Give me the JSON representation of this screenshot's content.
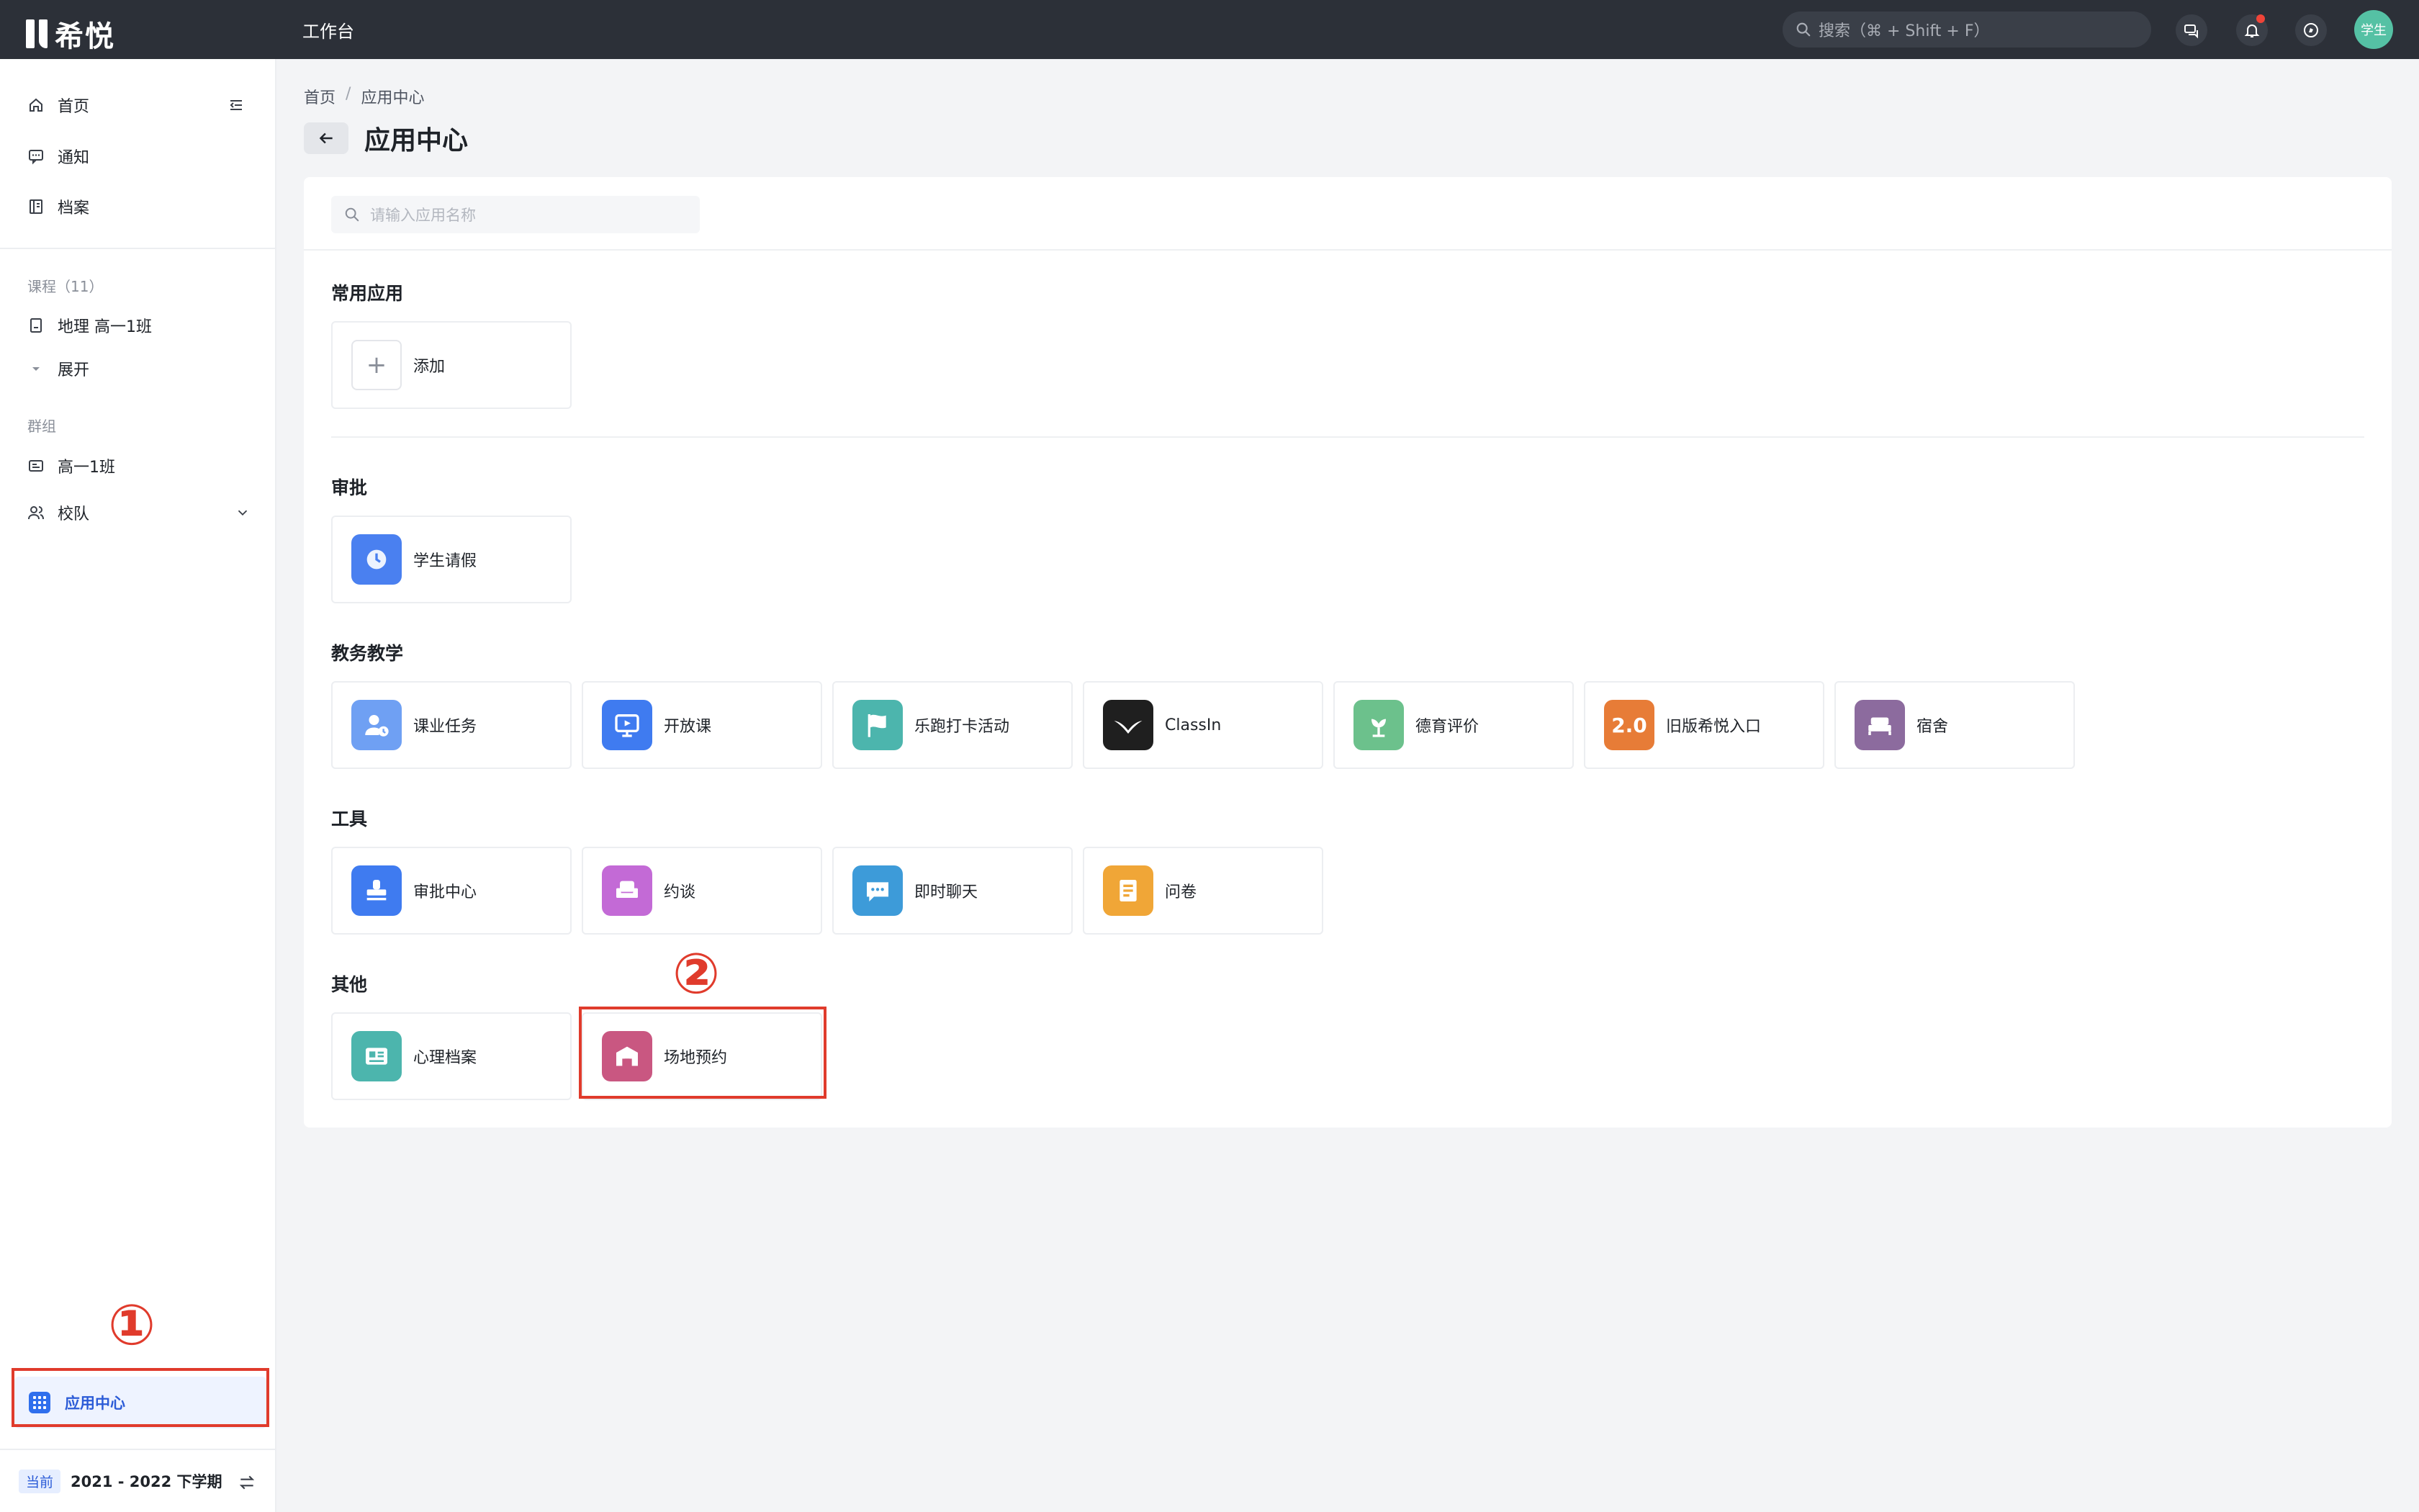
{
  "colors": {
    "topbar": "#2c3038",
    "accent": "#2b5bd7",
    "annotation": "#e03b2c",
    "notify_dot": "#f04438",
    "avatar": "#55c1a4"
  },
  "topbar": {
    "logo_text": "希悦",
    "title": "工作台",
    "search_placeholder": "搜索（⌘ + Shift + F）",
    "avatar_text": "学生"
  },
  "sidebar": {
    "nav": [
      {
        "label": "首页",
        "icon": "home-icon"
      },
      {
        "label": "通知",
        "icon": "message-icon"
      },
      {
        "label": "档案",
        "icon": "archive-icon"
      }
    ],
    "courses_label": "课程（11）",
    "courses": [
      {
        "label": "地理 高一1班",
        "icon": "book-icon"
      }
    ],
    "expand_label": "展开",
    "groups_label": "群组",
    "groups": [
      {
        "label": "高一1班",
        "icon": "class-card-icon"
      },
      {
        "label": "校队",
        "icon": "people-icon"
      }
    ],
    "app_center_label": "应用中心",
    "term_badge": "当前",
    "term_text": "2021 - 2022 下学期"
  },
  "annotations": {
    "step1": "①",
    "step2": "②"
  },
  "main": {
    "breadcrumb": [
      "首页",
      "/",
      "应用中心"
    ],
    "title": "应用中心",
    "search_placeholder": "请输入应用名称",
    "groups": [
      {
        "title": "常用应用",
        "apps": [
          {
            "label": "添加",
            "icon": "plus-icon"
          }
        ]
      },
      {
        "title": "审批",
        "apps": [
          {
            "label": "学生请假",
            "icon": "clock-icon",
            "color": "#4a80f0"
          }
        ]
      },
      {
        "title": "教务教学",
        "apps": [
          {
            "label": "课业任务",
            "icon": "user-clock-icon",
            "color": "#6fa0f3"
          },
          {
            "label": "开放课",
            "icon": "screen-play-icon",
            "color": "#3f7bf0"
          },
          {
            "label": "乐跑打卡活动",
            "icon": "flag-icon",
            "color": "#4cb5ad"
          },
          {
            "label": "ClassIn",
            "icon": "classin-bird-icon",
            "color": "#1f1f1f"
          },
          {
            "label": "德育评价",
            "icon": "plant-icon",
            "color": "#6cc18c"
          },
          {
            "label": "旧版希悦入口",
            "icon": "version-2-icon",
            "icon_text": "2.0",
            "color": "#e77c37"
          },
          {
            "label": "宿舍",
            "icon": "bed-icon",
            "color": "#8c6b9e"
          }
        ]
      },
      {
        "title": "工具",
        "apps": [
          {
            "label": "审批中心",
            "icon": "stamp-icon",
            "color": "#3f7bf0"
          },
          {
            "label": "约谈",
            "icon": "chat-seat-icon",
            "color": "#c36ad6"
          },
          {
            "label": "即时聊天",
            "icon": "chat-bubble-icon",
            "color": "#3d9bd9"
          },
          {
            "label": "问卷",
            "icon": "questionnaire-icon",
            "color": "#f0a637"
          }
        ]
      },
      {
        "title": "其他",
        "apps": [
          {
            "label": "心理档案",
            "icon": "id-card-icon",
            "color": "#4cb5ad"
          },
          {
            "label": "场地预约",
            "icon": "venue-icon",
            "color": "#c95781"
          }
        ]
      }
    ]
  }
}
